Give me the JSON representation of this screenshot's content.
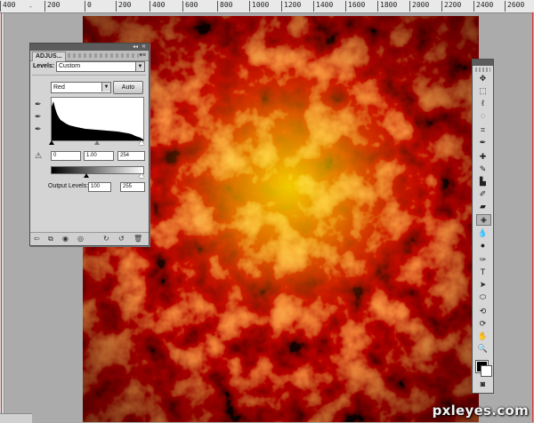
{
  "ruler": {
    "ticks": [
      "400",
      "200",
      "0",
      "200",
      "400",
      "600",
      "800",
      "1000",
      "1200",
      "1400",
      "1600",
      "1800",
      "2000",
      "2200",
      "2400",
      "2600"
    ]
  },
  "levels_panel": {
    "tab_label": "ADJUS...",
    "menu_icon": "panel-menu-icon",
    "preset_label": "Levels:",
    "preset_value": "Custom",
    "channel_value": "Red",
    "auto_label": "Auto",
    "input_levels": {
      "black": "0",
      "gamma": "1.00",
      "white": "254"
    },
    "output_label": "Output Levels:",
    "output_levels": {
      "black": "100",
      "white": "255"
    },
    "footer_icons": [
      "return-to-list-icon",
      "expanded-view-icon",
      "clip-to-layer-icon",
      "visibility-icon",
      "view-previous-icon",
      "reset-icon",
      "delete-icon"
    ]
  },
  "tools": {
    "names": [
      "move",
      "marquee",
      "lasso",
      "quick-selection",
      "crop",
      "eyedropper",
      "spot-healing-brush",
      "brush",
      "clone-stamp",
      "history-brush",
      "eraser",
      "paint-bucket",
      "blur",
      "dodge",
      "pen",
      "type",
      "path-selection",
      "ellipse",
      "3d-rotate",
      "3d-orbit",
      "hand",
      "zoom"
    ],
    "active": "paint-bucket",
    "foreground_color": "#000000",
    "background_color": "#ffffff"
  },
  "watermark": "pxleyes.com"
}
